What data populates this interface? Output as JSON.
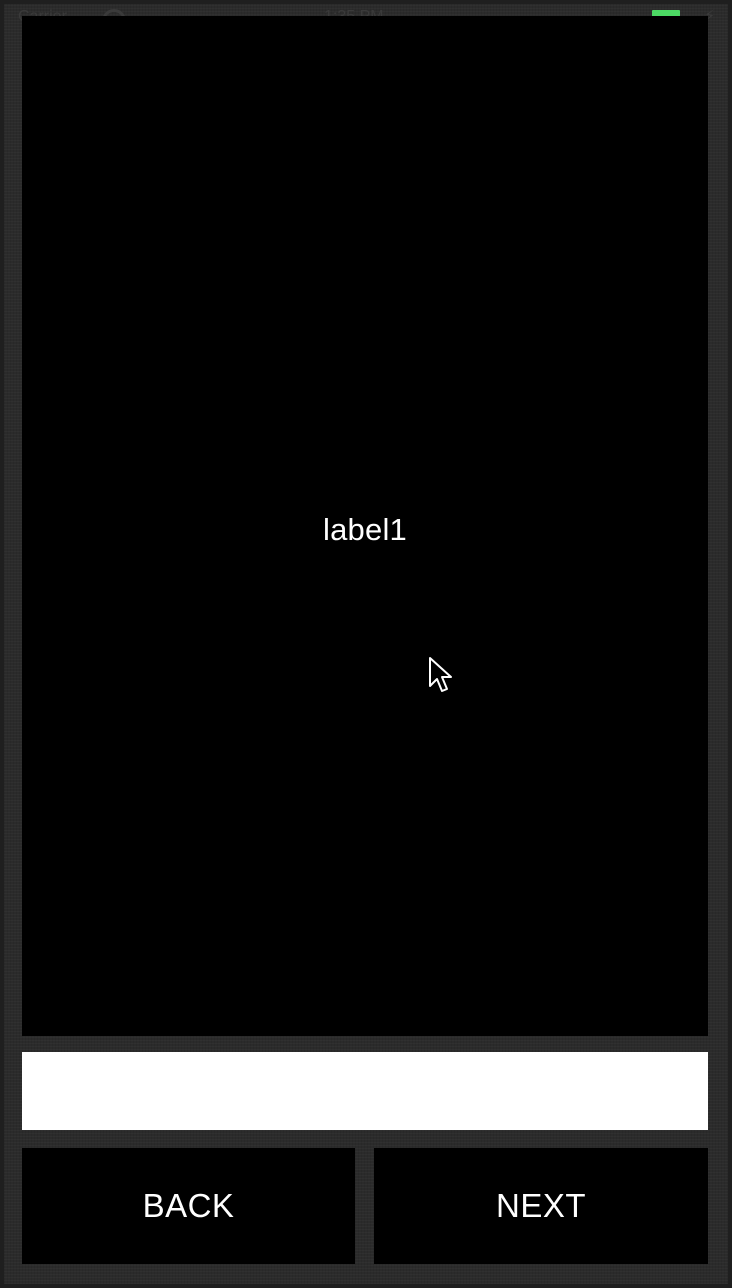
{
  "status_bar": {
    "carrier": "Carrier",
    "time": "1:35 PM",
    "battery_color": "#4cd964",
    "icons": [
      "wifi-icon",
      "battery-icon",
      "charge-icon"
    ]
  },
  "display": {
    "label": "label1",
    "background": "#000000",
    "text_color": "#ffffff"
  },
  "input": {
    "value": "",
    "placeholder": ""
  },
  "buttons": {
    "back_label": "BACK",
    "next_label": "NEXT"
  }
}
